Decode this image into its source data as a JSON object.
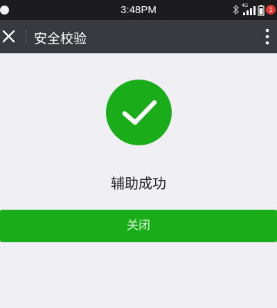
{
  "status_bar": {
    "time": "3:48PM",
    "network_label": "4G",
    "notification_count": "1",
    "icons": [
      "bluetooth-icon",
      "signal-icon",
      "battery-icon"
    ]
  },
  "header": {
    "title": "安全校验",
    "close_icon": "close-icon",
    "more_icon": "more-vertical-icon"
  },
  "main": {
    "status_icon": "check-circle-icon",
    "message": "辅助成功",
    "button_label": "关闭"
  },
  "colors": {
    "accent": "#1aad19",
    "header_bg": "#393a3f",
    "page_bg": "#efeff4"
  }
}
